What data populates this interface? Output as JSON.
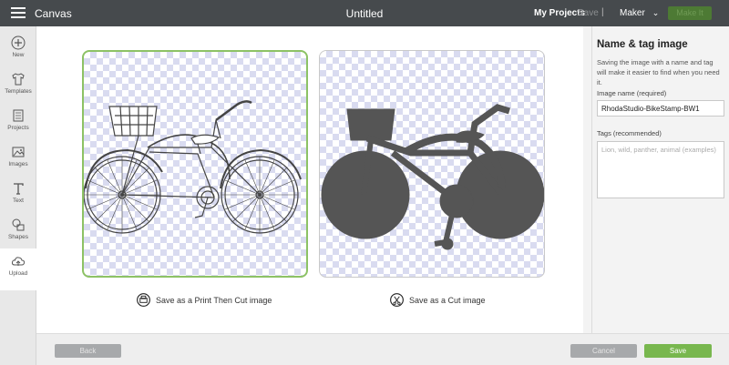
{
  "topbar": {
    "app_title": "Canvas",
    "doc_title": "Untitled",
    "my_projects": "My Projects",
    "save": "Save",
    "separator": "|",
    "machine": "Maker",
    "make_it": "Make It"
  },
  "sidebar": {
    "items": [
      {
        "label": "New",
        "icon": "plus-circle-icon"
      },
      {
        "label": "Templates",
        "icon": "shirt-icon"
      },
      {
        "label": "Projects",
        "icon": "grid-icon"
      },
      {
        "label": "Images",
        "icon": "image-icon"
      },
      {
        "label": "Text",
        "icon": "text-t-icon"
      },
      {
        "label": "Shapes",
        "icon": "shapes-icon"
      },
      {
        "label": "Upload",
        "icon": "cloud-upload-icon"
      }
    ],
    "active": "Upload"
  },
  "options": {
    "print_then_cut": "Save as a Print Then Cut image",
    "cut": "Save as a Cut image",
    "selected": "print_then_cut"
  },
  "panel": {
    "title": "Name & tag image",
    "description": "Saving the image with a name and tag will make it easier to find when you need it.",
    "name_label": "Image name (required)",
    "name_value": "RhodaStudio-BikeStamp-BW1",
    "tags_label": "Tags (recommended)",
    "tags_placeholder": "Lion, wild, panther, animal (examples)"
  },
  "bottom": {
    "back": "Back",
    "cancel": "Cancel",
    "save": "Save"
  },
  "colors": {
    "topbar": "#464a4d",
    "accent_green": "#78b74e",
    "selected_border": "#8dc265",
    "silhouette": "#555555"
  }
}
